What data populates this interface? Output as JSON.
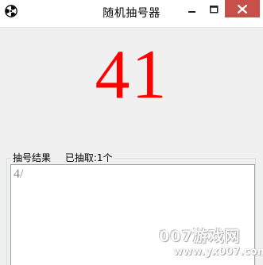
{
  "window": {
    "title": "随机抽号器",
    "accent_close_color": "#c7504b"
  },
  "titlebar": {
    "app_icon": "radiation-icon",
    "minimize_icon": "minimize-icon",
    "maximize_icon": "maximize-icon",
    "close_icon": "close-icon"
  },
  "display": {
    "current_number": "41",
    "number_color": "#ff0000"
  },
  "results": {
    "group_label": "抽号结果",
    "count_label": "已抽取:1个",
    "text": "4/"
  },
  "watermark": {
    "main": "007游戏网",
    "url": "www.yx007.com"
  }
}
